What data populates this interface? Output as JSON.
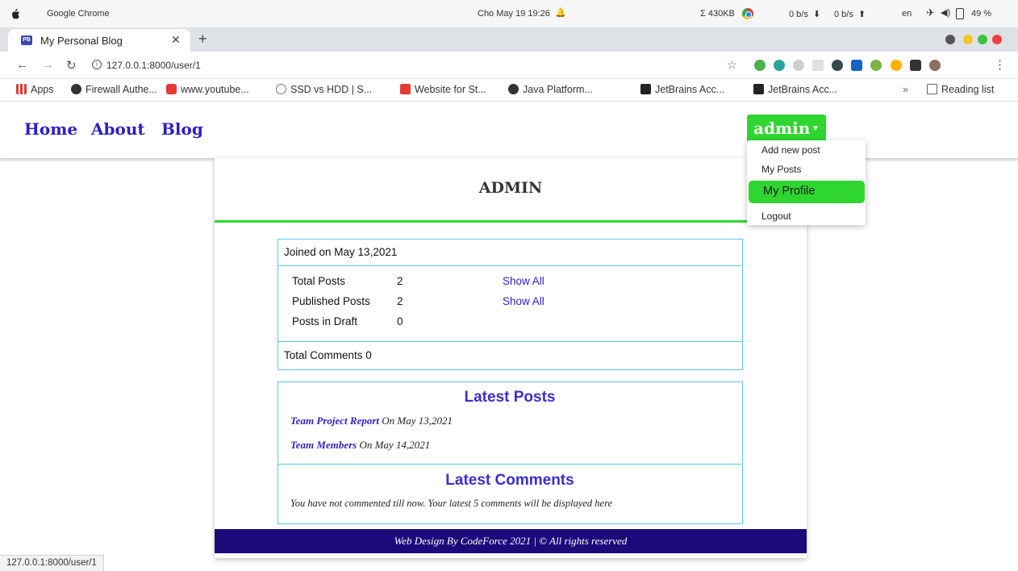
{
  "os": {
    "app_name": "Google Chrome",
    "clock": "Cho May 19  19:26",
    "net_summary": "Σ 430KB",
    "download_rate": "0 b/s",
    "upload_rate": "0 b/s",
    "language": "en",
    "battery": "49 %"
  },
  "browser": {
    "tab_title": "My Personal Blog",
    "favicon_text": "PB",
    "url": "127.0.0.1:8000/user/1",
    "bookmarks": [
      {
        "label": "Apps",
        "color": "#e53935"
      },
      {
        "label": "Firewall Authe...",
        "color": "#333333"
      },
      {
        "label": "www.youtube...",
        "color": "#e53935"
      },
      {
        "label": "SSD vs HDD | S...",
        "color": "#777777"
      },
      {
        "label": "Website for St...",
        "color": "#e53935"
      },
      {
        "label": "Java Platform...",
        "color": "#333333"
      },
      {
        "label": "JetBrains Acc...",
        "color": "#222222"
      },
      {
        "label": "JetBrains Acc...",
        "color": "#222222"
      }
    ],
    "reading_list": "Reading list",
    "status_url": "127.0.0.1:8000/user/1"
  },
  "nav": {
    "home": "Home",
    "about": "About",
    "blog": "Blog",
    "user": "admin"
  },
  "dropdown": {
    "items": [
      "Add new post",
      "My Posts",
      "My Profile",
      "Logout"
    ],
    "active": "My Profile"
  },
  "profile": {
    "title": "ADMIN",
    "joined": "Joined on May 13,2021",
    "stats": [
      {
        "label": "Total Posts",
        "value": "2",
        "action": "Show All"
      },
      {
        "label": "Published Posts",
        "value": "2",
        "action": "Show All"
      },
      {
        "label": "Posts in Draft",
        "value": "0",
        "action": ""
      }
    ],
    "total_comments": "Total Comments 0"
  },
  "latest_posts": {
    "heading": "Latest Posts",
    "items": [
      {
        "title": "Team Project Report",
        "date": "On May 13,2021"
      },
      {
        "title": "Team Members",
        "date": "On May 14,2021"
      }
    ]
  },
  "latest_comments": {
    "heading": "Latest Comments",
    "empty_text": "You have not commented till now. Your latest 5 comments will be displayed here"
  },
  "footer": "Web Design By CodeForce 2021 | © All rights reserved",
  "colors": {
    "accent_green": "#2fd62f",
    "link_blue": "#2b1fc7",
    "footer_navy": "#1a0a7a",
    "border_cyan": "#5bc8e8"
  }
}
